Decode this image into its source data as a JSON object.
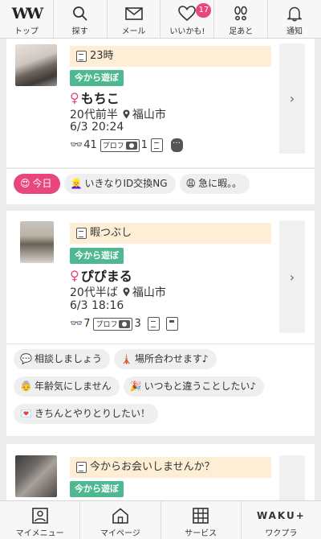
{
  "topnav": [
    {
      "label": "トップ",
      "icon": "logo-ww-icon",
      "logo_text": "WW"
    },
    {
      "label": "探す",
      "icon": "search-icon"
    },
    {
      "label": "メール",
      "icon": "mail-icon"
    },
    {
      "label": "いいかも!",
      "icon": "heart-icon",
      "badge": "17"
    },
    {
      "label": "足あと",
      "icon": "footprint-icon"
    },
    {
      "label": "通知",
      "icon": "bell-icon"
    }
  ],
  "posts": [
    {
      "memo": "23時",
      "asobo": "今から遊ぼ",
      "name": "もちこ",
      "age": "20代前半",
      "city": "福山市",
      "datetime": "6/3 20:24",
      "views": "41",
      "proff_label": "プロフ",
      "photos": "1"
    },
    {
      "memo": "暇つぶし",
      "asobo": "今から遊ぼ",
      "name": "ぴぴまる",
      "age": "20代半ば",
      "city": "福山市",
      "datetime": "6/3 18:16",
      "views": "7",
      "proff_label": "プロフ",
      "photos": "3"
    },
    {
      "memo": "今からお会いしませんか？",
      "asobo": "今から遊ぼ"
    }
  ],
  "tags1": [
    {
      "emoji": "😍",
      "text": "今日"
    },
    {
      "emoji": "👱‍♀️",
      "text": "いきなりID交換NG"
    },
    {
      "emoji": "😩",
      "text": "急に暇。。"
    }
  ],
  "tags2": [
    {
      "emoji": "💬",
      "text": "相談しましょう"
    },
    {
      "emoji": "🗼",
      "text": "場所合わせます♪"
    },
    {
      "emoji": "👵",
      "text": "年齢気にしません"
    },
    {
      "emoji": "🎉",
      "text": "いつもと違うことしたい♪"
    },
    {
      "emoji": "💌",
      "text": "きちんとやりとりしたい！"
    }
  ],
  "bottombar": [
    {
      "label": "マイメニュー",
      "icon": "user-icon"
    },
    {
      "label": "マイページ",
      "icon": "home-icon"
    },
    {
      "label": "サービス",
      "icon": "grid-icon"
    },
    {
      "label": "ワクプラ",
      "icon": "wakuplus-icon",
      "logo_text": "WAKU+"
    }
  ],
  "colors": {
    "accent_pink": "#e8467c",
    "asobo_green": "#4fb890",
    "memo_bg": "#fdeed5"
  }
}
